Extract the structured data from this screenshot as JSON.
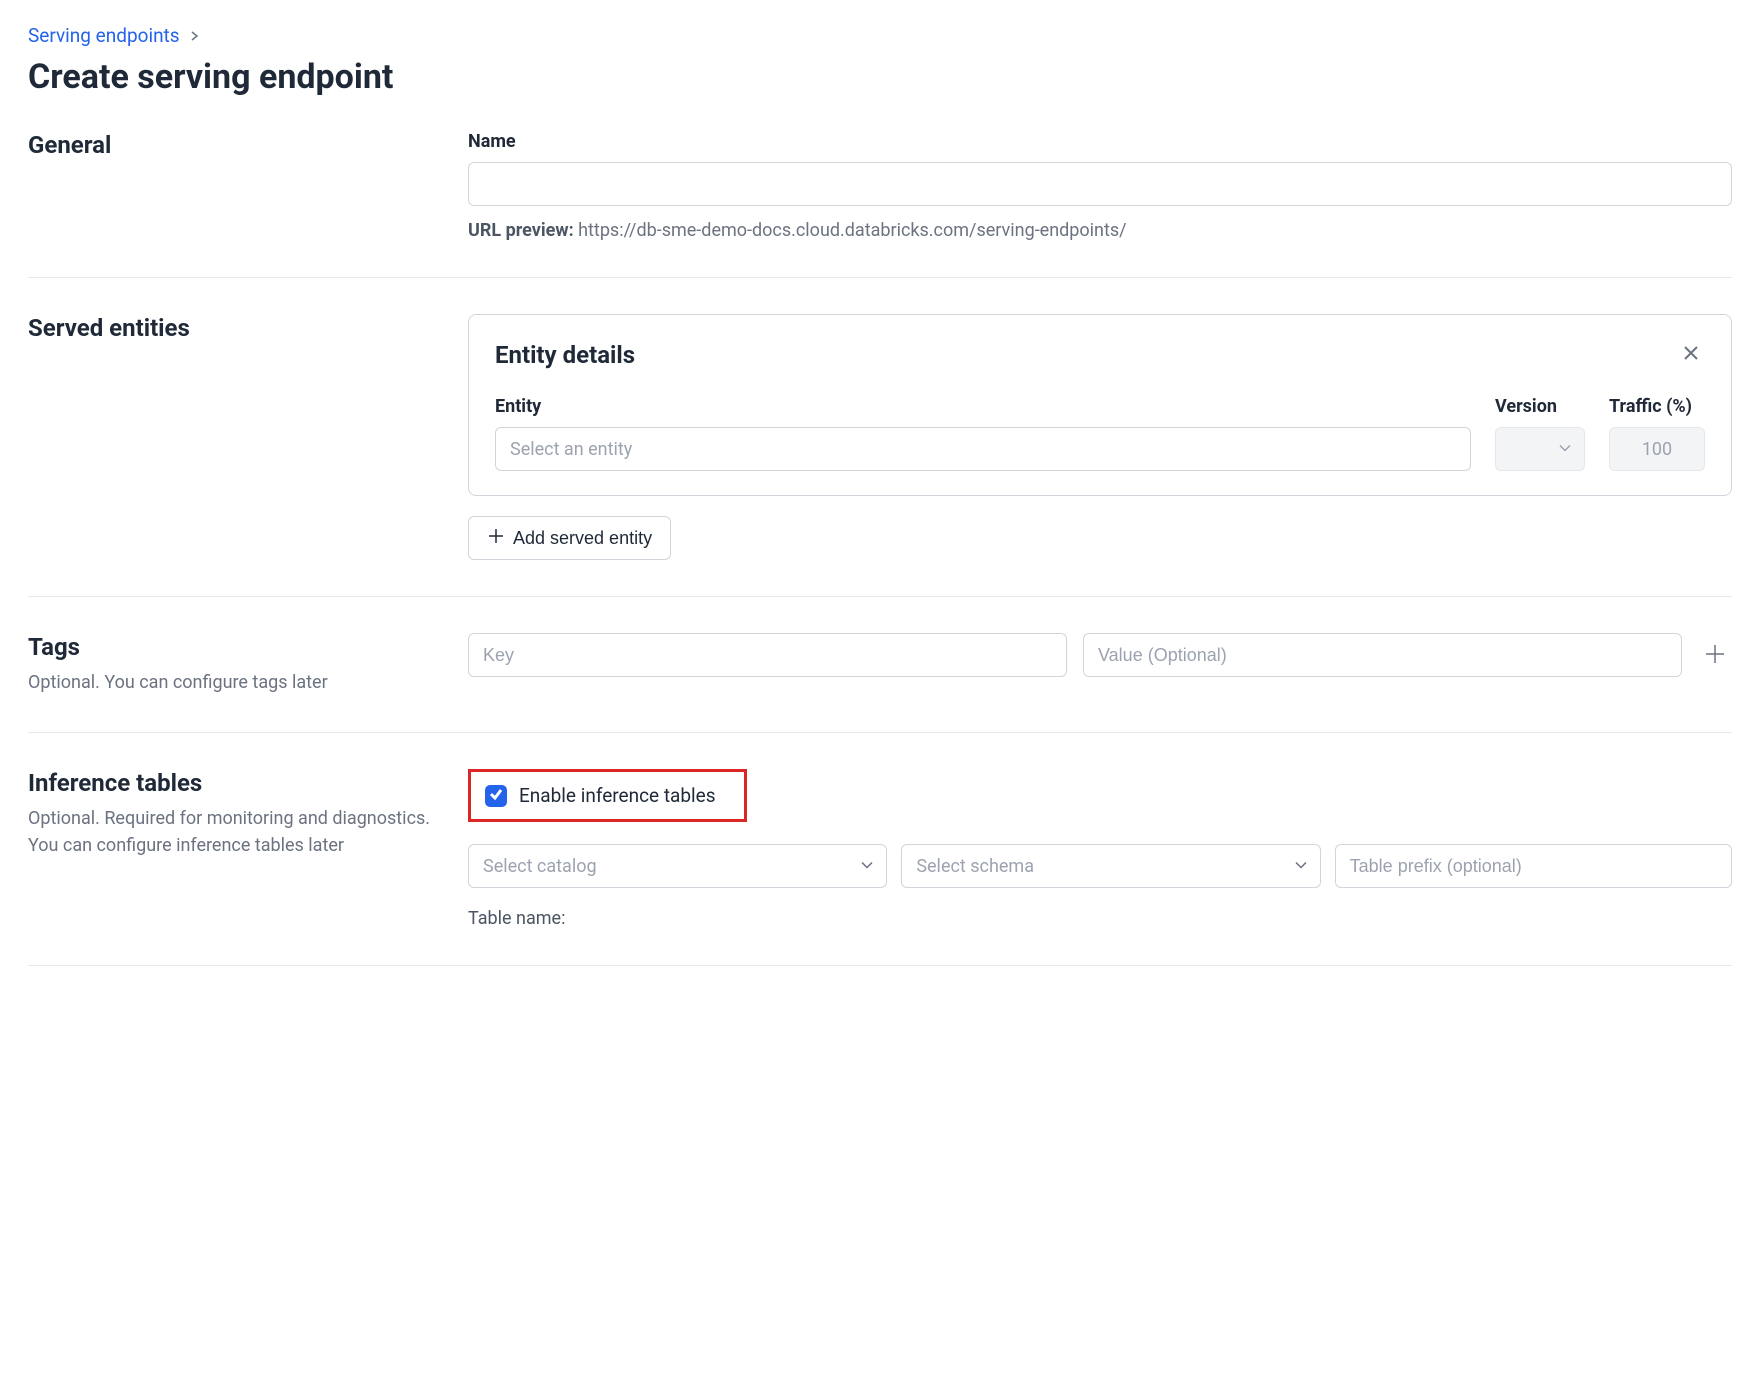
{
  "breadcrumb": {
    "link": "Serving endpoints"
  },
  "page_title": "Create serving endpoint",
  "general": {
    "title": "General",
    "name_label": "Name",
    "name_value": "",
    "url_preview_label": "URL preview:",
    "url_preview_value": "https://db-sme-demo-docs.cloud.databricks.com/serving-endpoints/"
  },
  "served": {
    "title": "Served entities",
    "card_title": "Entity details",
    "entity_label": "Entity",
    "entity_placeholder": "Select an entity",
    "version_label": "Version",
    "traffic_label": "Traffic (%)",
    "traffic_value": "100",
    "add_button": "Add served entity"
  },
  "tags": {
    "title": "Tags",
    "subtitle": "Optional. You can configure tags later",
    "key_placeholder": "Key",
    "value_placeholder": "Value (Optional)"
  },
  "inference": {
    "title": "Inference tables",
    "subtitle": "Optional. Required for monitoring and diagnostics. You can configure inference tables later",
    "checkbox_label": "Enable inference tables",
    "catalog_placeholder": "Select catalog",
    "schema_placeholder": "Select schema",
    "prefix_placeholder": "Table prefix (optional)",
    "table_name_label": "Table name:"
  }
}
